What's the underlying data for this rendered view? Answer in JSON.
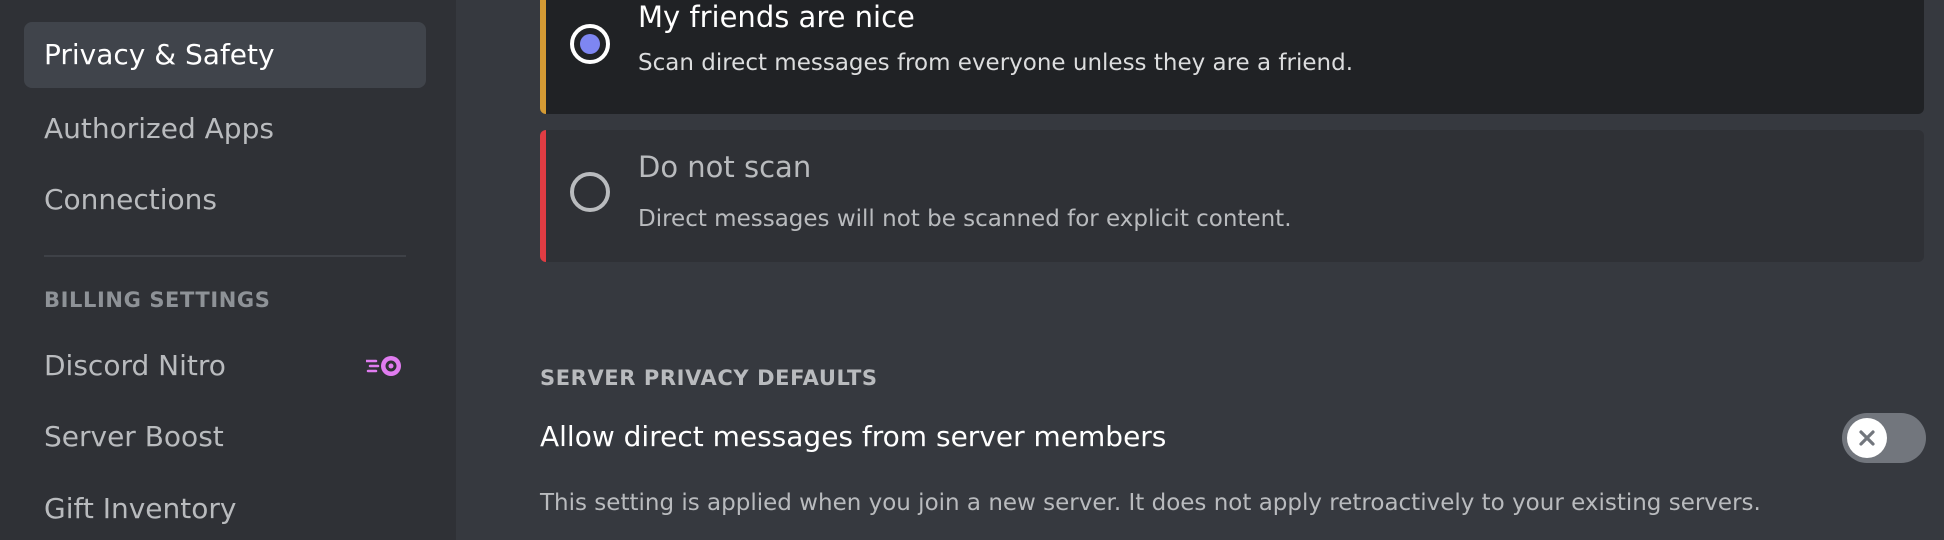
{
  "sidebar": {
    "items": [
      {
        "label": "Privacy & Safety",
        "selected": true
      },
      {
        "label": "Authorized Apps"
      },
      {
        "label": "Connections"
      }
    ],
    "billing_header": "BILLING SETTINGS",
    "billing_items": [
      {
        "label": "Discord Nitro",
        "icon": "nitro-icon"
      },
      {
        "label": "Server Boost"
      },
      {
        "label": "Gift Inventory"
      }
    ]
  },
  "scan_options": [
    {
      "title": "My friends are nice",
      "description": "Scan direct messages from everyone unless they are a friend.",
      "selected": true,
      "accent": "#d49a34"
    },
    {
      "title": "Do not scan",
      "description": "Direct messages will not be scanned for explicit content.",
      "selected": false,
      "accent": "#e03c43"
    }
  ],
  "server_privacy": {
    "header": "SERVER PRIVACY DEFAULTS",
    "setting_title": "Allow direct messages from server members",
    "setting_description": "This setting is applied when you join a new server. It does not apply retroactively to your existing servers.",
    "toggle_on": false,
    "toggle_icon": "close-icon"
  },
  "colors": {
    "accent_blurple": "#7e86f1",
    "nitro_pink": "#e07cf0"
  }
}
